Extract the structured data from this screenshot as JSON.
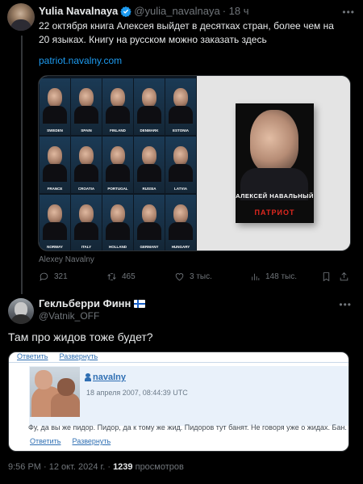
{
  "tweet": {
    "author_name": "Yulia Navalnaya",
    "author_handle": "@yulia_navalnaya",
    "time": "· 18 ч",
    "text": "22 октября книга Алексея выйдет в десятках стран, более чем на 20 языках. Книгу на русском можно заказать здесь",
    "link": "patriot.navalny.com",
    "media_caption": "Alexey Navalny",
    "countries": [
      "SWEDEN",
      "SPAIN",
      "FINLAND",
      "DENMARK",
      "ESTONIA",
      "FRANCE",
      "CROATIA",
      "PORTUGAL",
      "RUSSIA",
      "LATVIA",
      "NORWAY",
      "ITALY",
      "HOLLAND",
      "GERMANY",
      "HUNGARY"
    ],
    "book_author": "АЛЕКСЕЙ НАВАЛЬНЫЙ",
    "book_title": "ПАТРИОТ",
    "stats": {
      "replies": "321",
      "reposts": "465",
      "likes": "3 тыс.",
      "views": "148 тыс."
    }
  },
  "reply": {
    "author_name": "Гекльберри Финн",
    "author_handle": "@Vatnik_OFF",
    "text": "Там про жидов тоже будет?",
    "screenshot": {
      "top_links": [
        "Ответить",
        "Развернуть"
      ],
      "username": "navalny",
      "date": "18 апреля 2007, 08:44:39 UTC",
      "comment": "Фу, да вы же пидор. Пидор, да к тому же жид. Пидоров тут банят. Не говоря уже о жидах. Бан.",
      "bottom_links": [
        "Ответить",
        "Развернуть"
      ]
    },
    "timestamp": "9:56 PM · 12 окт. 2024 г. ·",
    "views_count": "1239",
    "views_label": "просмотров"
  },
  "colors": {
    "background": "#000000",
    "text": "#e7e9ea",
    "muted": "#71767b",
    "link": "#1d9bf0",
    "verified": "#1d9bf0"
  }
}
